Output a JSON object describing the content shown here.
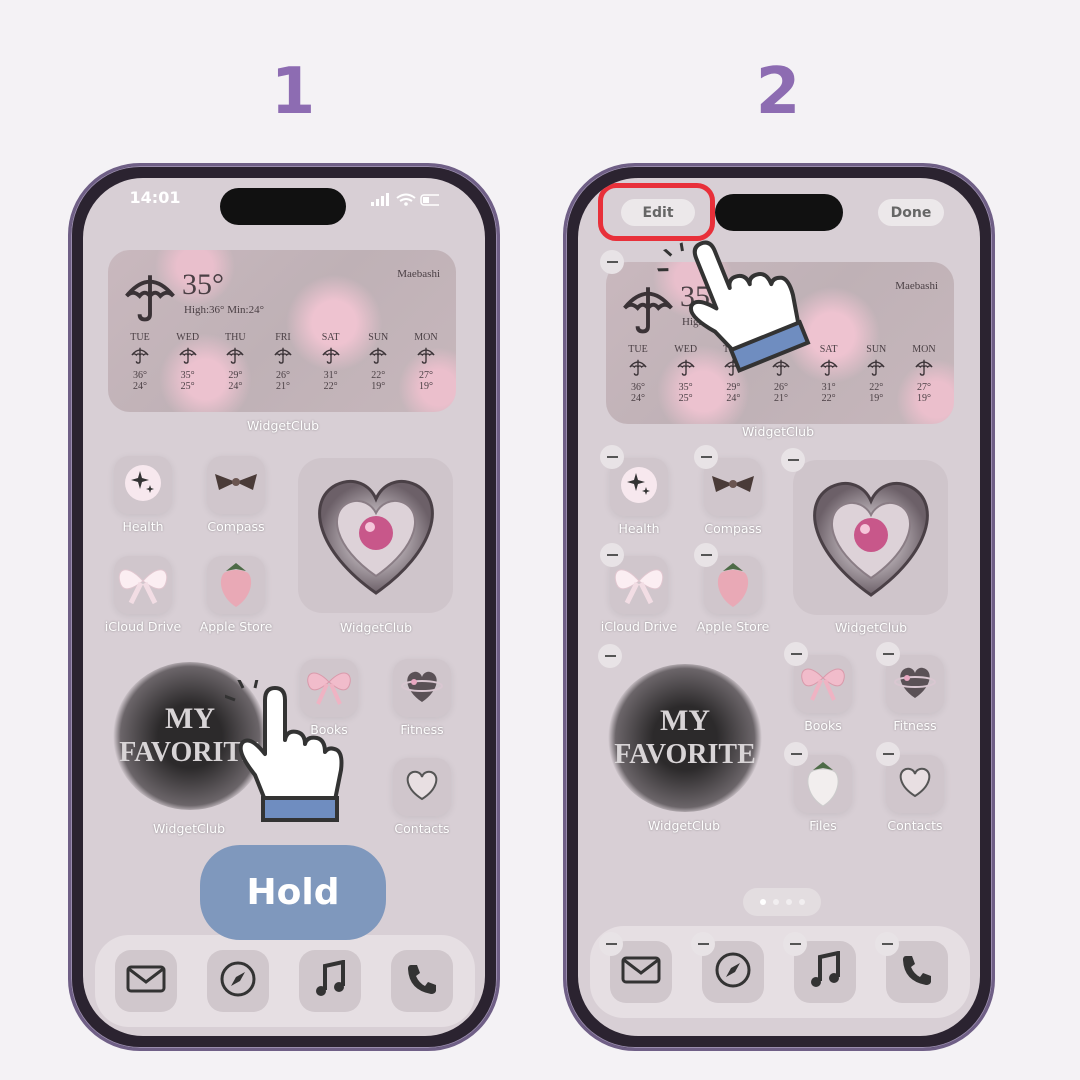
{
  "steps": [
    "1",
    "2"
  ],
  "colors": {
    "step_number": "#8d6cb2",
    "hold_button": "#7f98bd",
    "highlight": "#e8303a",
    "hand_cuff": "#6f8dc0"
  },
  "weather": {
    "icon": "umbrella-icon",
    "temp": "35°",
    "high_low": "High:36° Min:24°",
    "city": "Maebashi",
    "forecast": [
      {
        "day": "TUE",
        "high": "36°",
        "low": "24°"
      },
      {
        "day": "WED",
        "high": "35°",
        "low": "25°"
      },
      {
        "day": "THU",
        "high": "29°",
        "low": "24°"
      },
      {
        "day": "FRI",
        "high": "26°",
        "low": "21°"
      },
      {
        "day": "SAT",
        "high": "31°",
        "low": "22°"
      },
      {
        "day": "SUN",
        "high": "22°",
        "low": "19°"
      },
      {
        "day": "MON",
        "high": "27°",
        "low": "19°"
      }
    ]
  },
  "phone1": {
    "status_time": "14:01",
    "widget_labels": [
      "WidgetClub",
      "WidgetClub",
      "WidgetClub"
    ],
    "apps": [
      {
        "label": "Health",
        "icon": "sparkle-icon"
      },
      {
        "label": "Compass",
        "icon": "ribbon-icon"
      },
      {
        "label": "iCloud Drive",
        "icon": "bow-icon"
      },
      {
        "label": "Apple Store",
        "icon": "strawberry-icon"
      },
      {
        "label": "Books",
        "icon": "pink-bow-icon"
      },
      {
        "label": "Fitness",
        "icon": "heart-planet-icon"
      },
      {
        "label": "Contacts",
        "icon": "heart-icon"
      }
    ],
    "favorite_text": [
      "MY",
      "FAVORITE"
    ],
    "hold_label": "Hold",
    "dock": [
      "mail-icon",
      "compass-icon",
      "music-icon",
      "phone-icon"
    ]
  },
  "phone2": {
    "edit_label": "Edit",
    "done_label": "Done",
    "widget_labels": [
      "WidgetClub",
      "WidgetClub",
      "WidgetClub"
    ],
    "apps": [
      {
        "label": "Health",
        "icon": "sparkle-icon"
      },
      {
        "label": "Compass",
        "icon": "ribbon-icon"
      },
      {
        "label": "iCloud Drive",
        "icon": "bow-icon"
      },
      {
        "label": "Apple Store",
        "icon": "strawberry-icon"
      },
      {
        "label": "Books",
        "icon": "pink-bow-icon"
      },
      {
        "label": "Fitness",
        "icon": "heart-planet-icon"
      },
      {
        "label": "Files",
        "icon": "white-strawberry-icon"
      },
      {
        "label": "Contacts",
        "icon": "heart-icon"
      }
    ],
    "favorite_text": [
      "MY",
      "FAVORITE"
    ],
    "page_dots": {
      "count": 4,
      "active": 1
    },
    "dock": [
      "mail-icon",
      "compass-icon",
      "music-icon",
      "phone-icon"
    ]
  }
}
